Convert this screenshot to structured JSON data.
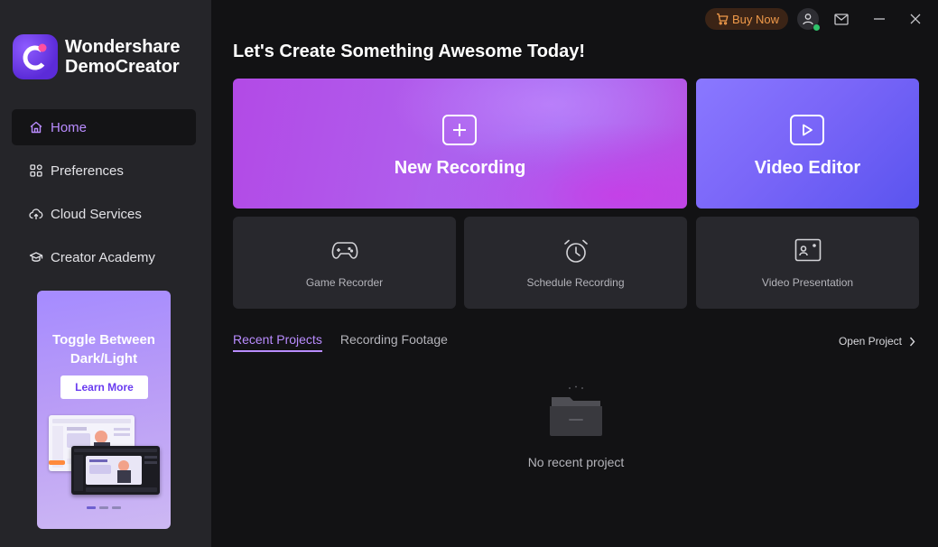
{
  "app": {
    "brand_line1": "Wondershare",
    "brand_line2": "DemoCreator"
  },
  "topbar": {
    "buy_now": "Buy Now",
    "accent": "#f09a4a"
  },
  "sidebar": {
    "items": [
      {
        "label": "Home",
        "icon": "home-icon",
        "active": true
      },
      {
        "label": "Preferences",
        "icon": "grid-icon",
        "active": false
      },
      {
        "label": "Cloud Services",
        "icon": "cloud-upload-icon",
        "active": false
      },
      {
        "label": "Creator Academy",
        "icon": "graduation-cap-icon",
        "active": false
      }
    ],
    "promo": {
      "title_line1": "Toggle Between",
      "title_line2": "Dark/Light",
      "button": "Learn More"
    }
  },
  "main": {
    "headline": "Let's Create Something Awesome Today!",
    "cards": {
      "new_recording": "New Recording",
      "video_editor": "Video Editor",
      "game_recorder": "Game Recorder",
      "schedule_recording": "Schedule Recording",
      "video_presentation": "Video Presentation"
    },
    "tabs": [
      {
        "label": "Recent Projects",
        "active": true
      },
      {
        "label": "Recording Footage",
        "active": false
      }
    ],
    "open_project": "Open Project",
    "empty_message": "No recent project"
  },
  "colors": {
    "accent_purple": "#b98cff",
    "sidebar_bg": "#252529",
    "main_bg": "#121214"
  }
}
